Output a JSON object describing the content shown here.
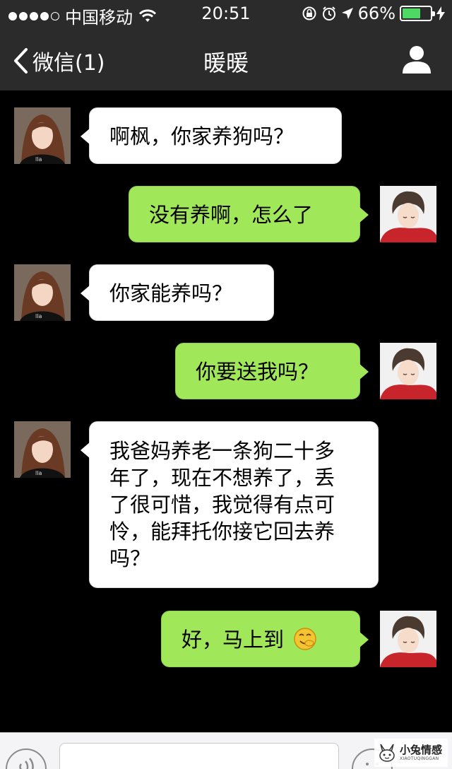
{
  "status_bar": {
    "carrier": "中国移动",
    "time": "20:51",
    "battery_percent": "66%",
    "battery_level": 0.66,
    "battery_color": "#4cd964",
    "signal_bars_filled": 4,
    "signal_bars_total": 5,
    "icons": [
      "wifi-icon",
      "rotation-lock-icon",
      "alarm-icon",
      "location-arrow-icon",
      "charging-bolt-icon"
    ]
  },
  "nav": {
    "back_label": "微信(1)",
    "title": "暖暖",
    "right_icon": "profile-icon",
    "background": "#2b2b2b"
  },
  "chat": {
    "background": "#000000",
    "incoming_bubble_color": "#ffffff",
    "outgoing_bubble_color": "#a0e75a",
    "messages": [
      {
        "from": "contact",
        "text": "啊枫，你家养狗吗？"
      },
      {
        "from": "me",
        "text": "没有养啊，怎么了"
      },
      {
        "from": "contact",
        "text": "你家能养吗？"
      },
      {
        "from": "me",
        "text": "你要送我吗？"
      },
      {
        "from": "contact",
        "lines": [
          "我爸妈养老一条狗二十多",
          "年了，现在不想养了，丢",
          "了很可惜，我觉得有点可",
          "怜，能拜托你接它回去养",
          "吗？"
        ]
      },
      {
        "from": "me",
        "text": "好，马上到",
        "emoji": "snicker-emoji-icon"
      }
    ]
  },
  "input_bar": {
    "left_icon": "voice-icon",
    "right_icon": "emoji-icon"
  },
  "watermark": {
    "title": "小兔情感",
    "subtitle": "XIAOTUQINGGAN"
  }
}
